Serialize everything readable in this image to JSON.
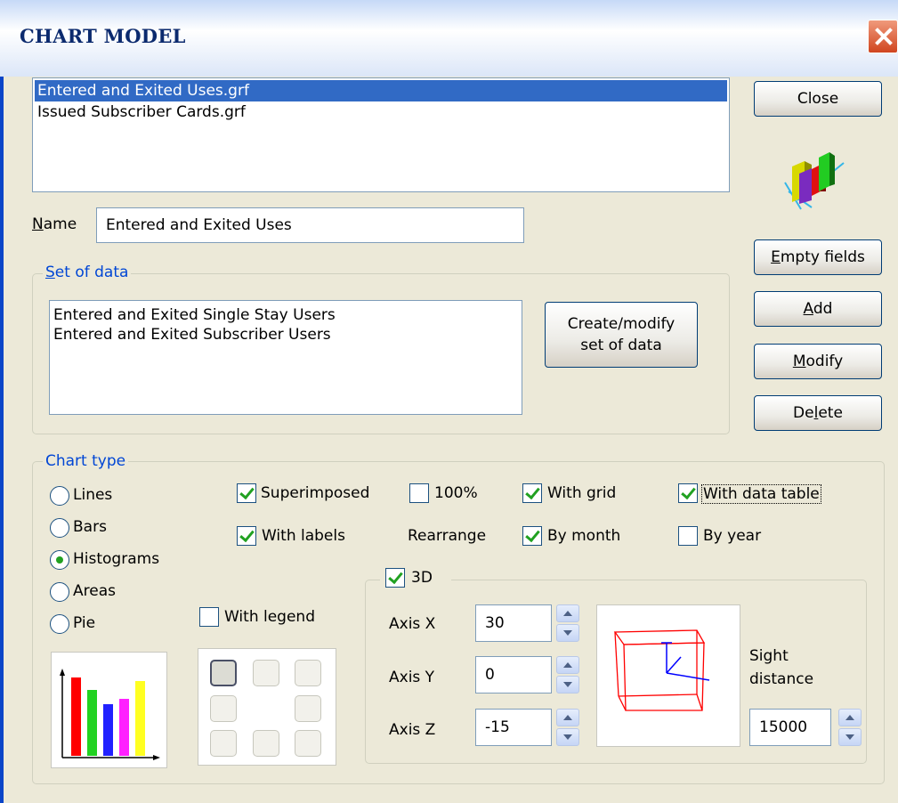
{
  "window": {
    "title": "CHART MODEL"
  },
  "files": {
    "items": [
      "Entered and Exited Uses.grf",
      "Issued Subscriber Cards.grf"
    ],
    "selected_index": 0
  },
  "name": {
    "label": "Name",
    "value": "Entered and Exited Uses"
  },
  "set_of_data": {
    "legend": "Set of data",
    "items": [
      "Entered and Exited Single Stay Users",
      "Entered and Exited Subscriber Users"
    ],
    "button_line1": "Create/modify",
    "button_line2": "set of data"
  },
  "buttons": {
    "close": "Close",
    "empty": "Empty fields",
    "add": "Add",
    "modify": "Modify",
    "delete": "Delete"
  },
  "chart_type": {
    "legend": "Chart type",
    "options": [
      {
        "label": "Lines",
        "checked": false
      },
      {
        "label": "Bars",
        "checked": false
      },
      {
        "label": "Histograms",
        "checked": true
      },
      {
        "label": "Areas",
        "checked": false
      },
      {
        "label": "Pie",
        "checked": false
      }
    ],
    "superimposed": "Superimposed",
    "pct100": "100%",
    "with_grid": "With grid",
    "with_data_table": "With data table",
    "with_labels": "With labels",
    "rearrange": "Rearrange",
    "by_month": "By month",
    "by_year": "By year",
    "with_legend": "With legend",
    "checks": {
      "superimposed": true,
      "pct100": false,
      "with_grid": true,
      "with_data_table": true,
      "with_labels": true,
      "by_month": true,
      "by_year": false,
      "with_legend": false,
      "three_d": true
    }
  },
  "three_d": {
    "label": "3D",
    "axis_x_label": "Axis X",
    "axis_x": "30",
    "axis_y_label": "Axis Y",
    "axis_y": "0",
    "axis_z_label": "Axis Z",
    "axis_z": "-15",
    "sight_label_1": "Sight",
    "sight_label_2": "distance",
    "sight_distance": "15000"
  },
  "preview_bar_colors": [
    "#ff0000",
    "#21d221",
    "#2121ff",
    "#ff21ff",
    "#ffff21"
  ],
  "accent_colors": {
    "selection": "#316ac5",
    "group_label": "#0046d5"
  }
}
